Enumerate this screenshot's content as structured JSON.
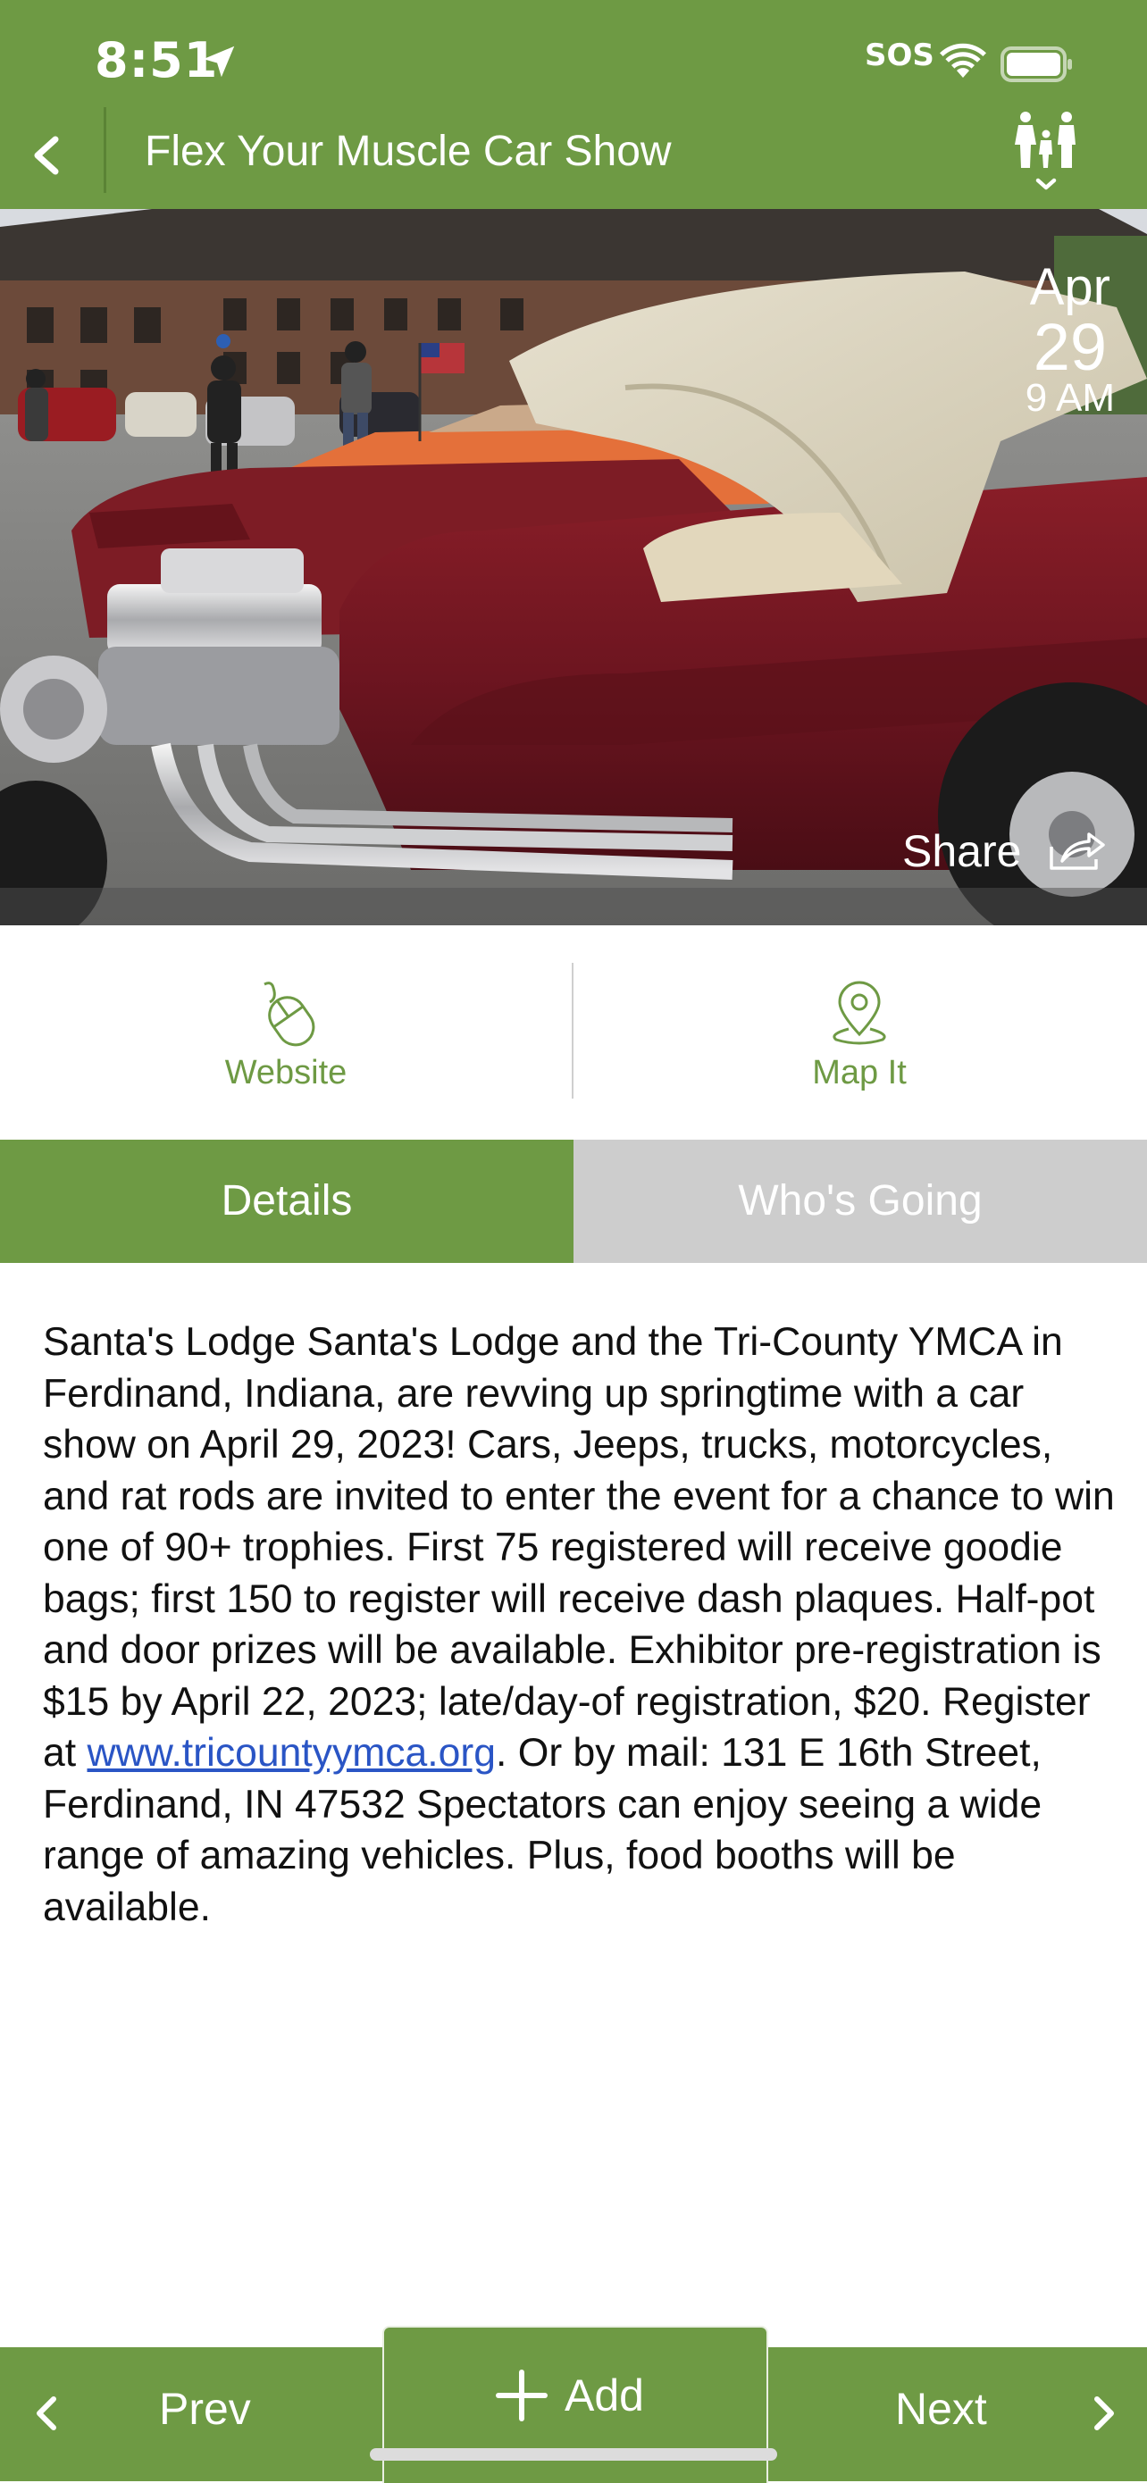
{
  "status_bar": {
    "time": "8:51",
    "sos": "SOS"
  },
  "nav": {
    "title": "Flex Your Muscle Car Show"
  },
  "event": {
    "date": {
      "month": "Apr",
      "day": "29",
      "time": "9 AM"
    },
    "share_label": "Share"
  },
  "actions": {
    "website_label": "Website",
    "map_label": "Map It"
  },
  "tabs": [
    {
      "label": "Details",
      "selected": true
    },
    {
      "label": "Who's Going",
      "selected": false
    }
  ],
  "description": {
    "text_before_link": "Santa's Lodge Santa's Lodge and the Tri-County YMCA in Ferdinand, Indiana, are revving up springtime with a car show on April 29, 2023! Cars, Jeeps, trucks, motorcycles, and rat rods are invited to enter the event for a chance to win one of 90+ trophies. First 75 registered will receive goodie bags; first 150 to register will receive dash plaques. Half-pot and door prizes will be available. Exhibitor pre-registration is $15 by April 22, 2023; late/day-of registration, $20. Register at ",
    "link_text": "www.tricountyymca.org",
    "text_after_link": ". Or by mail: 131 E 16th Street, Ferdinand, IN 47532 Spectators can enjoy seeing a wide range of amazing vehicles. Plus, food booths will be available."
  },
  "bottom_bar": {
    "prev_label": "Prev",
    "add_label": "Add",
    "next_label": "Next"
  },
  "colors": {
    "brand_green": "#6e9a44",
    "tab_inactive": "#cdcdcd",
    "link": "#2a55c5"
  }
}
